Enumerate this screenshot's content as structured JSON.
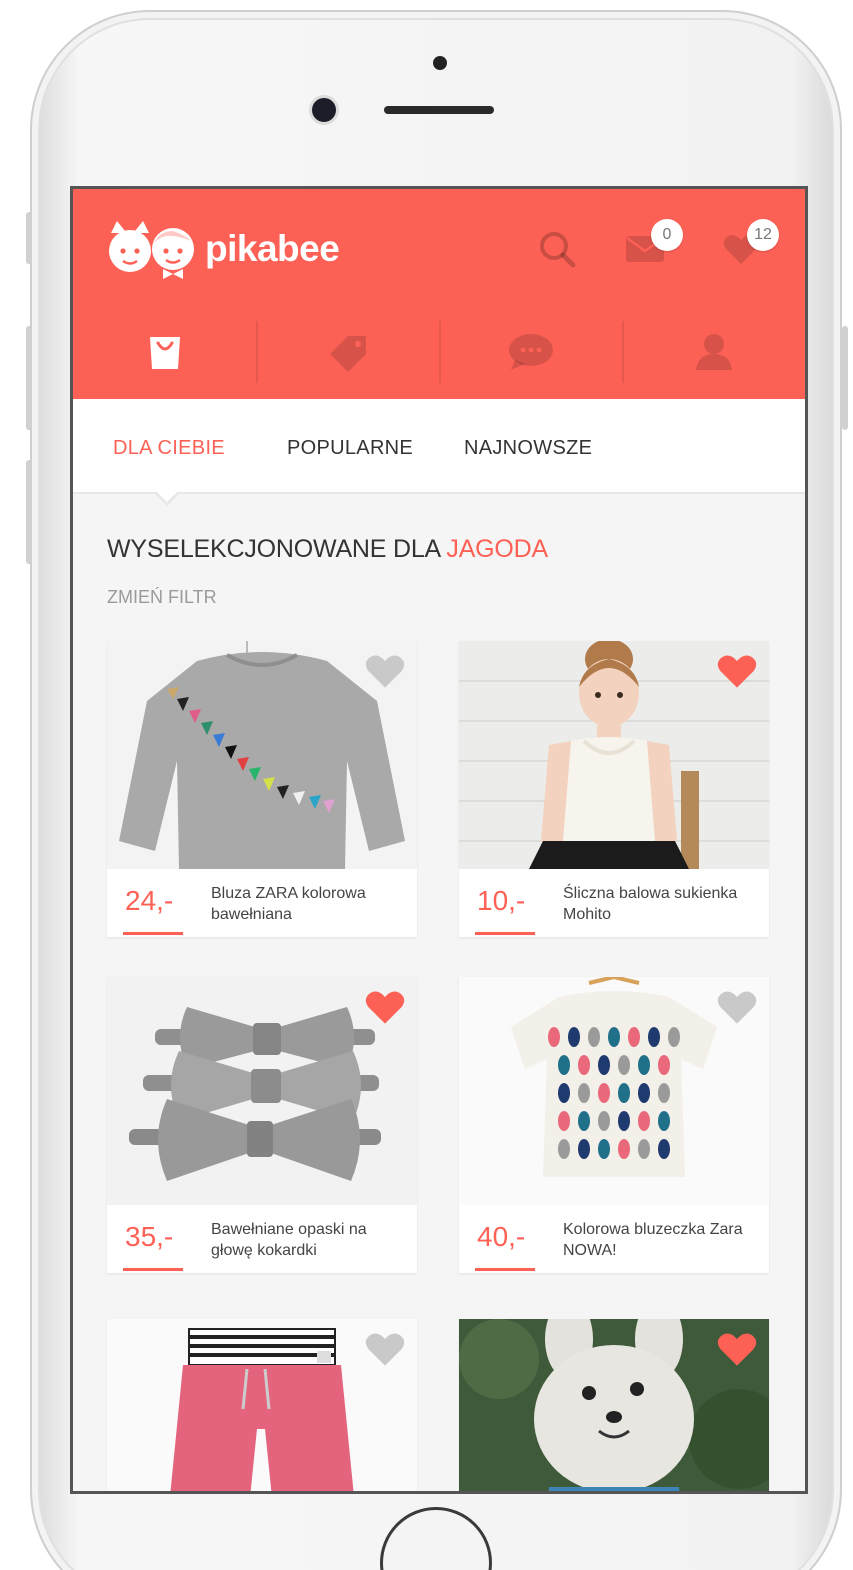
{
  "app": {
    "logo_text": "pikabee"
  },
  "header": {
    "search_icon": "search-icon",
    "messages": {
      "icon": "mail-icon",
      "count": "0"
    },
    "favorites": {
      "icon": "heart-icon",
      "count": "12"
    }
  },
  "nav": {
    "tabs": [
      {
        "icon": "shopping-bag-icon",
        "active": true
      },
      {
        "icon": "price-tag-icon",
        "active": false
      },
      {
        "icon": "chat-bubble-icon",
        "active": false
      },
      {
        "icon": "user-icon",
        "active": false
      }
    ]
  },
  "subtabs": {
    "for_you": "DLA CIEBIE",
    "popular": "POPULARNE",
    "newest": "NAJNOWSZE"
  },
  "section": {
    "title": "WYSELEKCJONOWANE DLA ",
    "user": "JAGODA",
    "filter": "ZMIEŃ FILTR"
  },
  "products": [
    {
      "price": "24,-",
      "title": "Bluza ZARA kolorowa bawełniana",
      "favorite": false
    },
    {
      "price": "10,-",
      "title": "Śliczna balowa sukienka Mohito",
      "favorite": true
    },
    {
      "price": "35,-",
      "title": "Bawełniane opaski na głowę kokardki",
      "favorite": true
    },
    {
      "price": "40,-",
      "title": "Kolorowa bluzeczka Zara NOWA!",
      "favorite": false
    },
    {
      "price": "",
      "title": "",
      "favorite": false
    },
    {
      "price": "",
      "title": "",
      "favorite": true
    }
  ],
  "colors": {
    "accent": "#fd6156",
    "fav_on": "#fd6156",
    "fav_off": "#c9c9c9"
  }
}
